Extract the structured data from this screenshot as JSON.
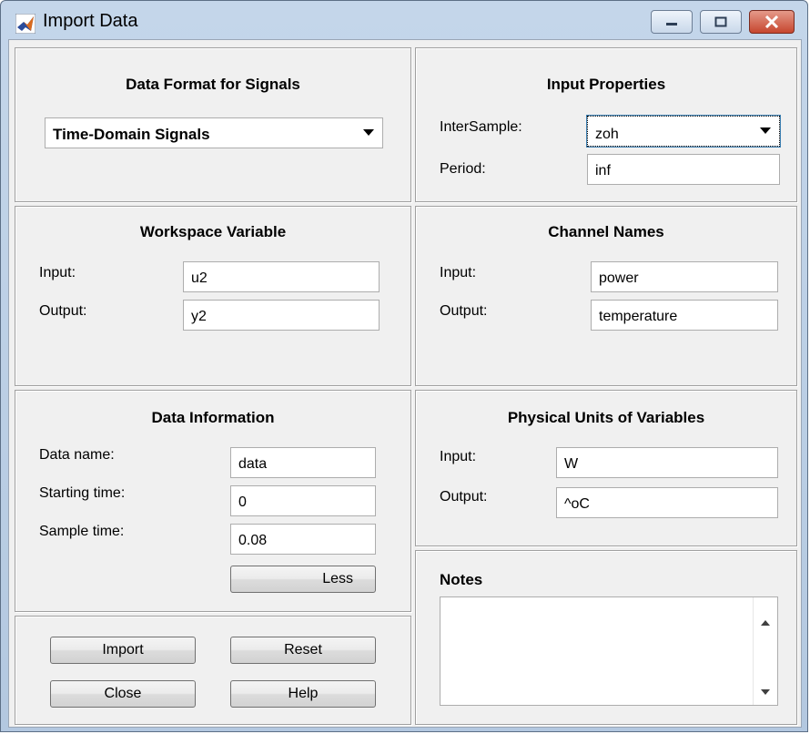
{
  "window": {
    "title": "Import Data"
  },
  "data_format": {
    "title": "Data Format for Signals",
    "selected": "Time-Domain Signals"
  },
  "input_properties": {
    "title": "Input Properties",
    "intersample_label": "InterSample:",
    "intersample_value": "zoh",
    "period_label": "Period:",
    "period_value": "inf"
  },
  "workspace_variable": {
    "title": "Workspace Variable",
    "input_label": "Input:",
    "input_value": "u2",
    "output_label": "Output:",
    "output_value": "y2"
  },
  "channel_names": {
    "title": "Channel Names",
    "input_label": "Input:",
    "input_value": "power",
    "output_label": "Output:",
    "output_value": "temperature"
  },
  "data_information": {
    "title": "Data Information",
    "name_label": "Data name:",
    "name_value": "data",
    "start_label": "Starting time:",
    "start_value": "0",
    "sample_label": "Sample time:",
    "sample_value": "0.08",
    "less_button": "Less"
  },
  "physical_units": {
    "title": "Physical Units of Variables",
    "input_label": "Input:",
    "input_value": "W",
    "output_label": "Output:",
    "output_value": "^oC"
  },
  "notes": {
    "title": "Notes",
    "value": ""
  },
  "actions": {
    "import": "Import",
    "reset": "Reset",
    "close": "Close",
    "help": "Help"
  }
}
